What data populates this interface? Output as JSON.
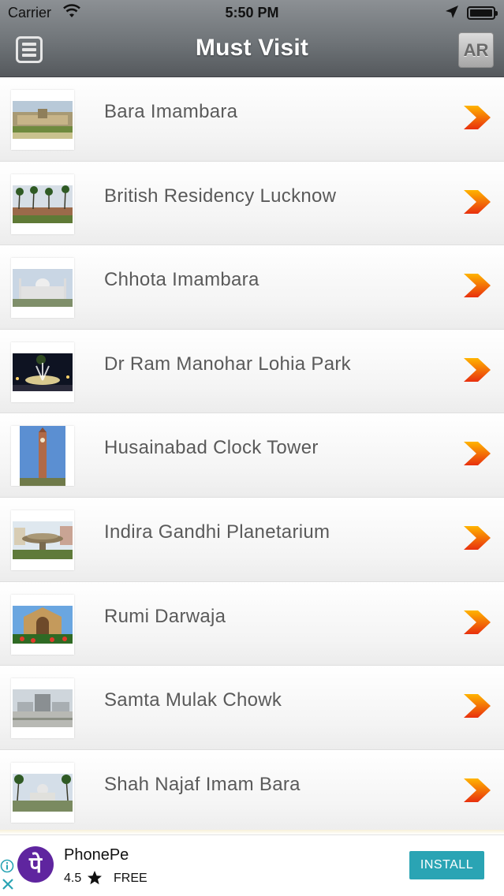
{
  "status_bar": {
    "carrier": "Carrier",
    "time": "5:50 PM"
  },
  "nav": {
    "title": "Must Visit",
    "ar_label": "AR",
    "menu_icon": "hamburger-menu-icon"
  },
  "places": [
    {
      "name": "Bara Imambara"
    },
    {
      "name": "British Residency Lucknow"
    },
    {
      "name": "Chhota Imambara"
    },
    {
      "name": "Dr Ram Manohar Lohia Park"
    },
    {
      "name": "Husainabad Clock Tower"
    },
    {
      "name": "Indira Gandhi Planetarium"
    },
    {
      "name": "Rumi Darwaja"
    },
    {
      "name": "Samta Mulak Chowk"
    },
    {
      "name": "Shah Najaf Imam Bara"
    }
  ],
  "ad": {
    "app_name": "PhonePe",
    "logo_glyph": "पे",
    "rating": "4.5",
    "price": "FREE",
    "install_label": "INSTALL",
    "brand_color": "#5f259f",
    "button_color": "#2aa4b4"
  },
  "colors": {
    "chevron_orange": "#f05a16",
    "chevron_yellow": "#ffb400",
    "label_gray": "#5a5a5a"
  }
}
